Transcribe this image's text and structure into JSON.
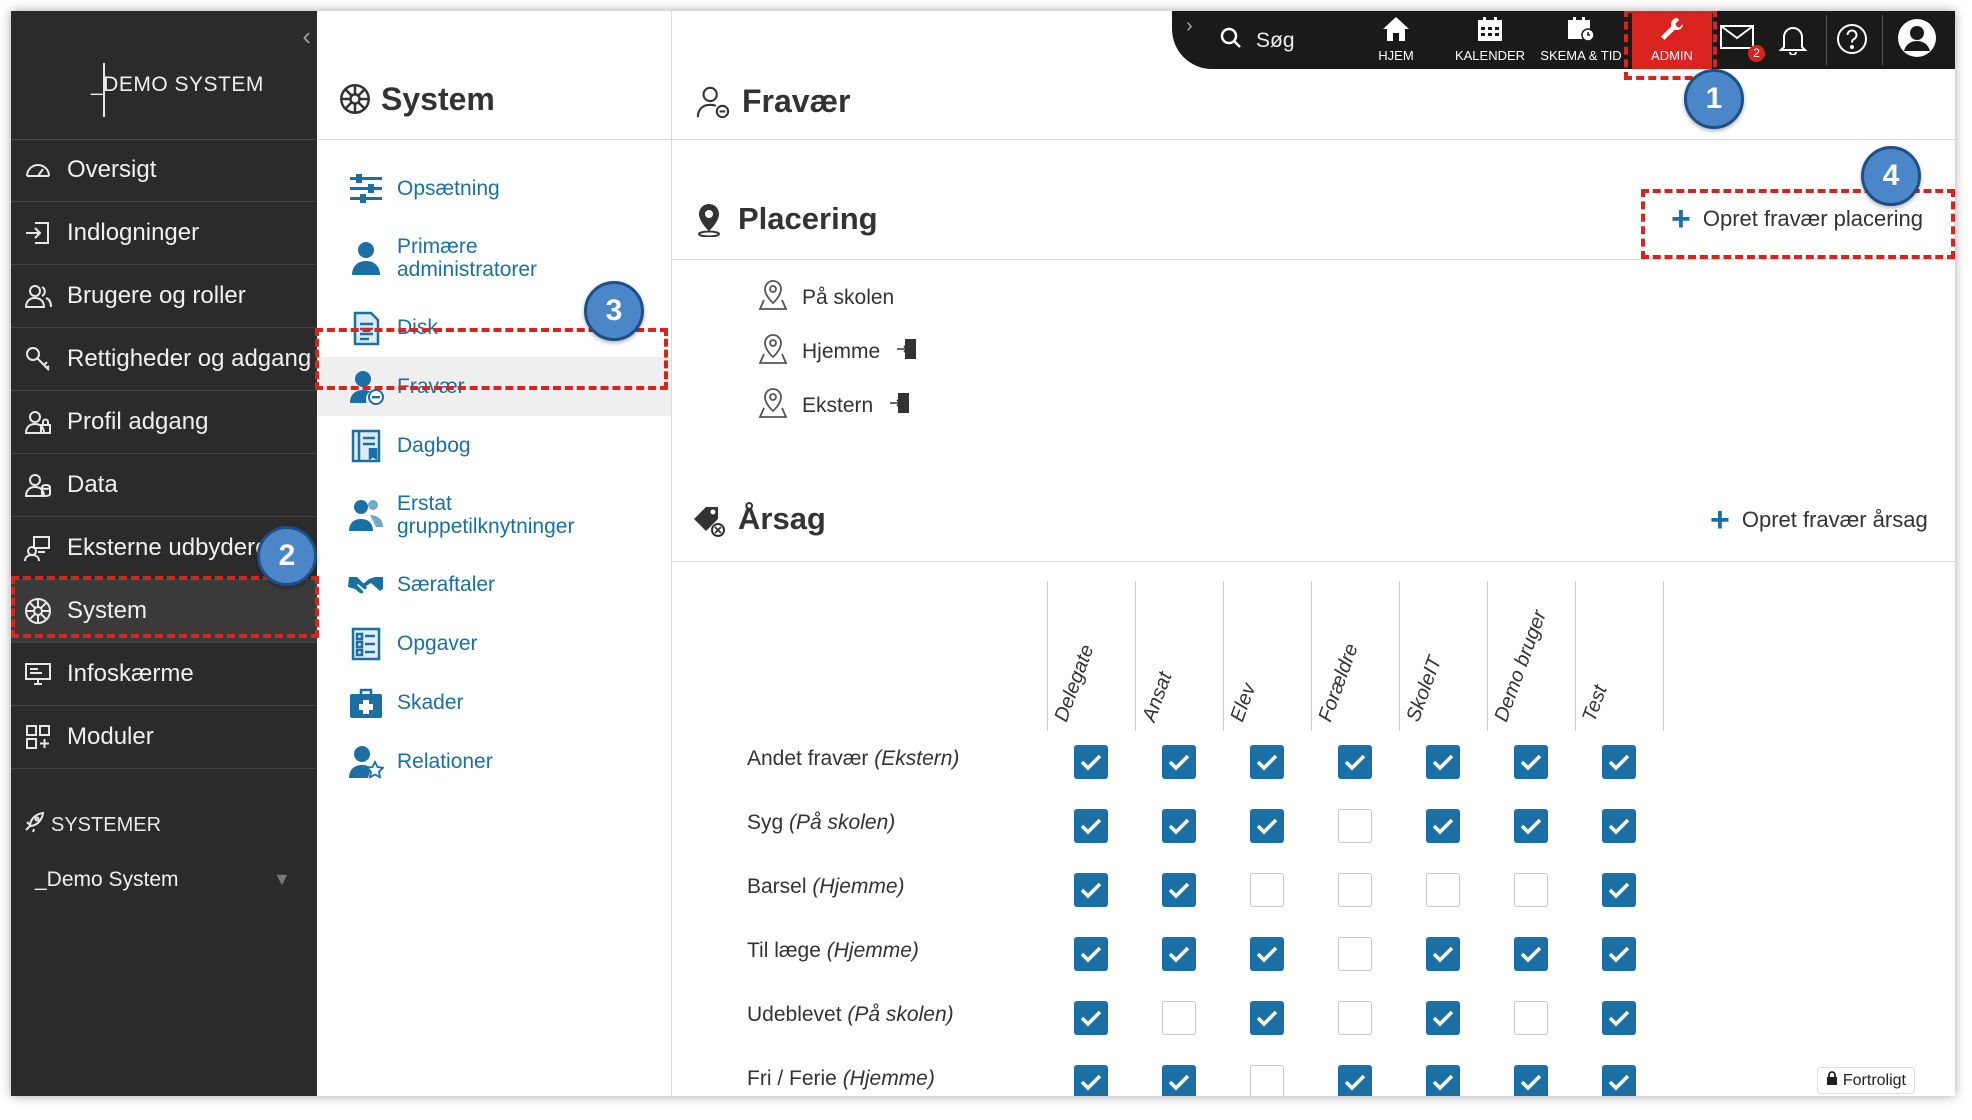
{
  "brand": {
    "logo_text": "_DEMO SYSTEM"
  },
  "sidebar": {
    "items": [
      {
        "label": "Oversigt",
        "icon": "gauge-icon"
      },
      {
        "label": "Indlogninger",
        "icon": "login-icon"
      },
      {
        "label": "Brugere og roller",
        "icon": "users-icon"
      },
      {
        "label": "Rettigheder og adgang",
        "icon": "key-icon"
      },
      {
        "label": "Profil adgang",
        "icon": "profile-access-icon"
      },
      {
        "label": "Data",
        "icon": "data-icon"
      },
      {
        "label": "Eksterne udbydere",
        "icon": "external-providers-icon"
      },
      {
        "label": "System",
        "icon": "system-wheel-icon",
        "active": true
      },
      {
        "label": "Infoskærme",
        "icon": "monitor-icon"
      },
      {
        "label": "Moduler",
        "icon": "modules-icon"
      }
    ],
    "systems_heading": "SYSTEMER",
    "system_selector": "_Demo System"
  },
  "system_menu": {
    "title": "System",
    "items": [
      {
        "label": "Opsætning",
        "icon": "sliders-icon"
      },
      {
        "label": "Primære administratorer",
        "icon": "admin-person-icon"
      },
      {
        "label": "Disk",
        "icon": "document-icon"
      },
      {
        "label": "Fravær",
        "icon": "absence-person-icon",
        "active": true
      },
      {
        "label": "Dagbog",
        "icon": "diary-icon"
      },
      {
        "label": "Erstat gruppetilknytninger",
        "icon": "group-replace-icon"
      },
      {
        "label": "Særaftaler",
        "icon": "handshake-icon"
      },
      {
        "label": "Opgaver",
        "icon": "tasks-icon"
      },
      {
        "label": "Skader",
        "icon": "first-aid-icon"
      },
      {
        "label": "Relationer",
        "icon": "relations-icon"
      }
    ]
  },
  "topbar": {
    "search_label": "Søg",
    "nav": [
      {
        "label": "HJEM",
        "icon": "home-icon"
      },
      {
        "label": "KALENDER",
        "icon": "calendar-icon"
      },
      {
        "label": "SKEMA & TID",
        "icon": "schedule-icon"
      },
      {
        "label": "ADMIN",
        "icon": "wrench-icon",
        "active": true
      }
    ],
    "mail_badge": "2"
  },
  "page": {
    "title": "Fravær",
    "placement": {
      "title": "Placering",
      "create_label": "Opret fravær placering",
      "locations": [
        {
          "label": "På skolen",
          "exit_icon": false
        },
        {
          "label": "Hjemme",
          "exit_icon": true
        },
        {
          "label": "Ekstern",
          "exit_icon": true
        }
      ]
    },
    "reason": {
      "title": "Årsag",
      "create_label": "Opret fravær årsag",
      "columns": [
        "Delegate",
        "Ansat",
        "Elev",
        "Forældre",
        "SkoleIT",
        "Demo bruger",
        "Test"
      ],
      "rows": [
        {
          "name": "Andet fravær",
          "location": "(Ekstern)",
          "checks": [
            true,
            true,
            true,
            true,
            true,
            true,
            true
          ]
        },
        {
          "name": "Syg",
          "location": "(På skolen)",
          "checks": [
            true,
            true,
            true,
            false,
            true,
            true,
            true
          ]
        },
        {
          "name": "Barsel",
          "location": "(Hjemme)",
          "checks": [
            true,
            true,
            false,
            false,
            false,
            false,
            true
          ]
        },
        {
          "name": "Til læge",
          "location": "(Hjemme)",
          "checks": [
            true,
            true,
            true,
            false,
            true,
            true,
            true
          ]
        },
        {
          "name": "Udeblevet",
          "location": "(På skolen)",
          "checks": [
            true,
            false,
            true,
            false,
            true,
            false,
            true
          ]
        },
        {
          "name": "Fri / Ferie",
          "location": "(Hjemme)",
          "checks": [
            true,
            true,
            false,
            true,
            true,
            true,
            true
          ]
        }
      ]
    },
    "confidential_label": "Fortroligt"
  },
  "callouts": [
    "1",
    "2",
    "3",
    "4"
  ],
  "colors": {
    "accent": "#1b6fa3",
    "highlight": "#d8231e",
    "callout": "#4a86c8",
    "sidebar": "#2b2b2b"
  }
}
